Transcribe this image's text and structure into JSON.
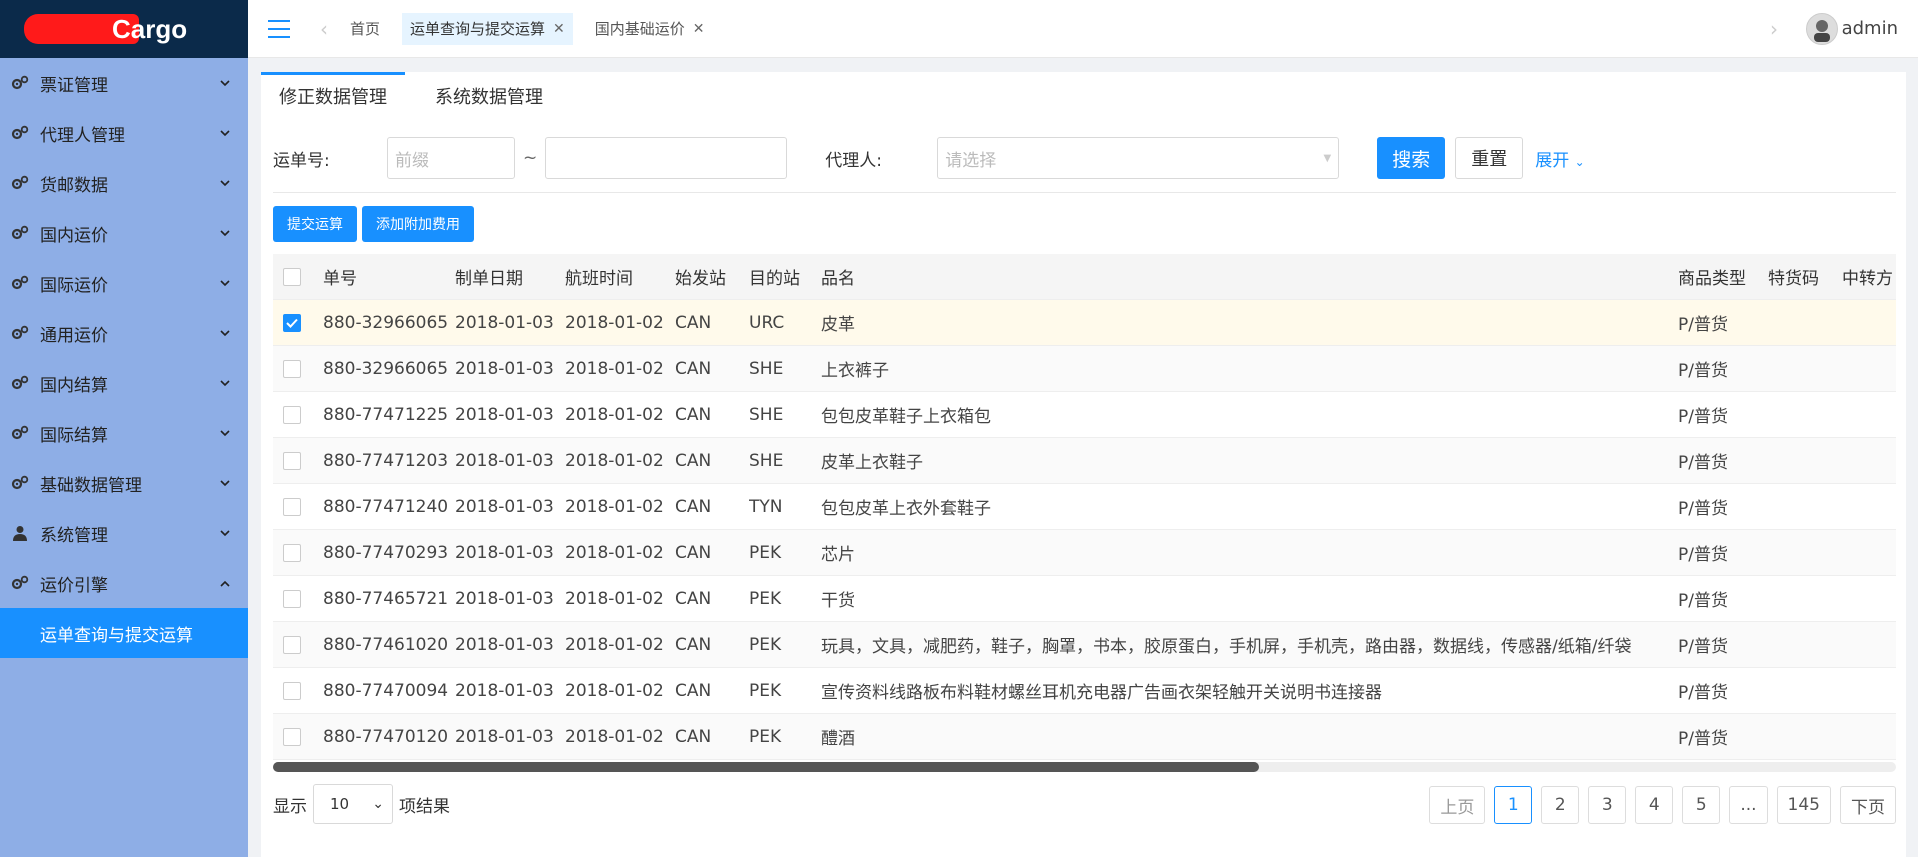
{
  "sidebar": {
    "logo_text": "Cargo",
    "items": [
      {
        "label": "票证管理",
        "icon": "gears-icon"
      },
      {
        "label": "代理人管理",
        "icon": "gears-icon"
      },
      {
        "label": "货邮数据",
        "icon": "gears-icon"
      },
      {
        "label": "国内运价",
        "icon": "gears-icon"
      },
      {
        "label": "国际运价",
        "icon": "gears-icon"
      },
      {
        "label": "通用运价",
        "icon": "gears-icon"
      },
      {
        "label": "国内结算",
        "icon": "gears-icon"
      },
      {
        "label": "国际结算",
        "icon": "gears-icon"
      },
      {
        "label": "基础数据管理",
        "icon": "gears-icon"
      },
      {
        "label": "系统管理",
        "icon": "user-icon"
      },
      {
        "label": "运价引擎",
        "icon": "gears-icon"
      }
    ],
    "active_submenu": "运单查询与提交运算"
  },
  "topbar": {
    "tabs": [
      {
        "label": "首页"
      },
      {
        "label": "运单查询与提交运算"
      },
      {
        "label": "国内基础运价"
      }
    ],
    "user": "admin"
  },
  "main": {
    "content_tabs": [
      "修正数据管理",
      "系统数据管理"
    ],
    "search": {
      "waybill_label": "运单号:",
      "prefix_placeholder": "前缀",
      "tilde": "~",
      "agent_label": "代理人:",
      "agent_placeholder": "请选择",
      "search_button": "搜索",
      "reset_button": "重置",
      "expand_link": "展开"
    },
    "actions": {
      "submit": "提交运算",
      "add_fee": "添加附加费用"
    },
    "table": {
      "headers": [
        "单号",
        "制单日期",
        "航班时间",
        "始发站",
        "目的站",
        "品名",
        "商品类型",
        "特货码",
        "中转方"
      ],
      "rows": [
        {
          "no": "880-32966065",
          "date": "2018-01-03",
          "flight": "2018-01-02",
          "from": "CAN",
          "to": "URC",
          "name": "皮革",
          "type": "P/普货",
          "checked": true
        },
        {
          "no": "880-32966065",
          "date": "2018-01-03",
          "flight": "2018-01-02",
          "from": "CAN",
          "to": "SHE",
          "name": "上衣裤子",
          "type": "P/普货",
          "checked": false
        },
        {
          "no": "880-77471225",
          "date": "2018-01-03",
          "flight": "2018-01-02",
          "from": "CAN",
          "to": "SHE",
          "name": "包包皮革鞋子上衣箱包",
          "type": "P/普货",
          "checked": false
        },
        {
          "no": "880-77471203",
          "date": "2018-01-03",
          "flight": "2018-01-02",
          "from": "CAN",
          "to": "SHE",
          "name": "皮革上衣鞋子",
          "type": "P/普货",
          "checked": false
        },
        {
          "no": "880-77471240",
          "date": "2018-01-03",
          "flight": "2018-01-02",
          "from": "CAN",
          "to": "TYN",
          "name": "包包皮革上衣外套鞋子",
          "type": "P/普货",
          "checked": false
        },
        {
          "no": "880-77470293",
          "date": "2018-01-03",
          "flight": "2018-01-02",
          "from": "CAN",
          "to": "PEK",
          "name": "芯片",
          "type": "P/普货",
          "checked": false
        },
        {
          "no": "880-77465721",
          "date": "2018-01-03",
          "flight": "2018-01-02",
          "from": "CAN",
          "to": "PEK",
          "name": "干货",
          "type": "P/普货",
          "checked": false
        },
        {
          "no": "880-77461020",
          "date": "2018-01-03",
          "flight": "2018-01-02",
          "from": "CAN",
          "to": "PEK",
          "name": "玩具，文具，减肥药，鞋子，胸罩，书本，胶原蛋白，手机屏，手机壳，路由器，数据线，传感器/纸箱/纤袋",
          "type": "P/普货",
          "checked": false
        },
        {
          "no": "880-77470094",
          "date": "2018-01-03",
          "flight": "2018-01-02",
          "from": "CAN",
          "to": "PEK",
          "name": "宣传资料线路板布料鞋材螺丝耳机充电器广告画衣架轻触开关说明书连接器",
          "type": "P/普货",
          "checked": false
        },
        {
          "no": "880-77470120",
          "date": "2018-01-03",
          "flight": "2018-01-02",
          "from": "CAN",
          "to": "PEK",
          "name": "醴酒",
          "type": "P/普货",
          "checked": false
        }
      ]
    },
    "footer": {
      "show_label": "显示",
      "page_size": "10",
      "result_label": "项结果",
      "prev": "上页",
      "next": "下页",
      "pages": [
        "1",
        "2",
        "3",
        "4",
        "5",
        "...",
        "145"
      ],
      "current_page": "1"
    }
  },
  "colors": {
    "primary": "#1890ff",
    "sidebar_bg": "#8eaee6",
    "logo_bg": "#0b2a4a"
  }
}
